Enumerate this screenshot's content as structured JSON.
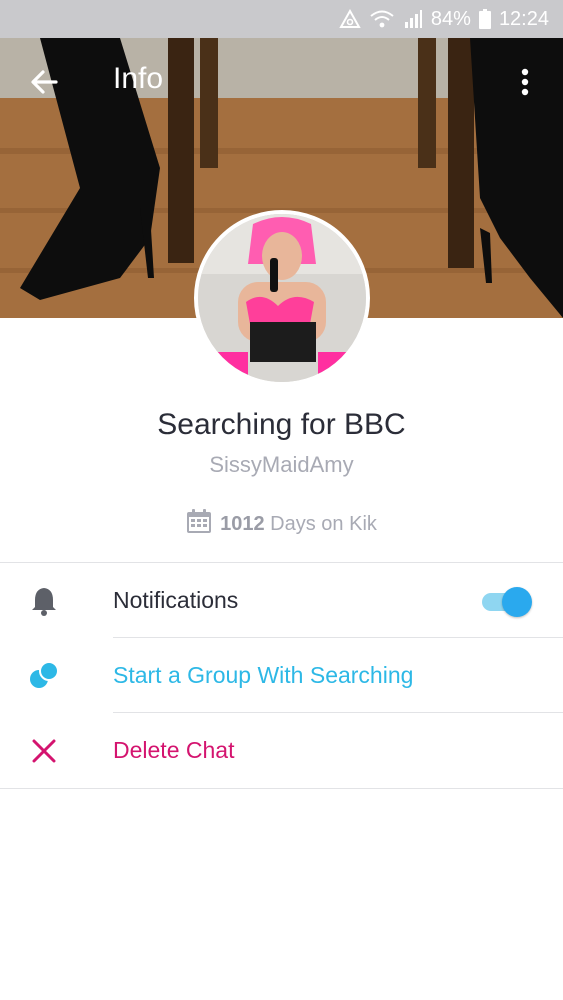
{
  "status_bar": {
    "battery_percent": "84%",
    "time": "12:24",
    "icons": [
      "data-saver-icon",
      "wifi-icon",
      "signal-icon",
      "battery-icon"
    ]
  },
  "header": {
    "title": "Info",
    "back_icon": "arrow-left-icon",
    "menu_icon": "more-vertical-icon"
  },
  "profile": {
    "display_name": "Searching for BBC",
    "username": "SissyMaidAmy",
    "days_count": "1012",
    "days_suffix": "Days on Kik",
    "calendar_icon": "calendar-icon"
  },
  "actions": {
    "notifications": {
      "label": "Notifications",
      "icon": "bell-icon",
      "enabled": true
    },
    "start_group": {
      "label": "Start a Group With Searching",
      "icon": "group-icon"
    },
    "delete_chat": {
      "label": "Delete Chat",
      "icon": "close-icon"
    }
  },
  "colors": {
    "accent_blue": "#2db8e6",
    "delete_pink": "#d4146f",
    "toggle_on": "#2aa9ee",
    "muted_text": "#a8aab4"
  }
}
